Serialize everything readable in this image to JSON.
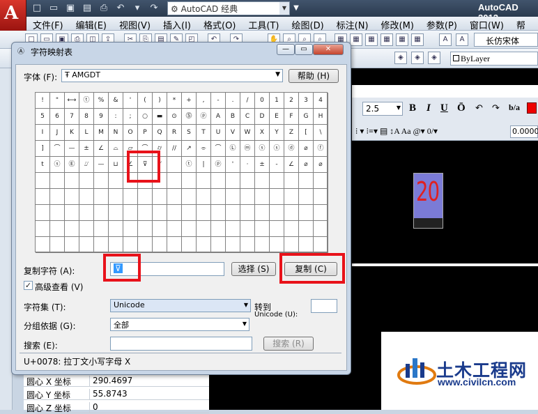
{
  "app": {
    "title": "AutoCAD 2012",
    "logo": "A",
    "workspace": "AutoCAD 经典"
  },
  "menus": [
    "文件(F)",
    "编辑(E)",
    "视图(V)",
    "插入(I)",
    "格式(O)",
    "工具(T)",
    "绘图(D)",
    "标注(N)",
    "修改(M)",
    "参数(P)",
    "窗口(W)",
    "帮"
  ],
  "toolbar": {
    "font_name": "长仿宋体",
    "layer_color": "ByLayer"
  },
  "text_editor": {
    "height": "2.5",
    "b": "B",
    "i": "I",
    "u": "U",
    "o": "Ō",
    "oblique": "0.0000",
    "color_accent": "#dd0000"
  },
  "drawing": {
    "mtext": "20"
  },
  "properties": [
    {
      "key": "圆心 X 坐标",
      "value": "290.4697"
    },
    {
      "key": "圆心 Y 坐标",
      "value": "55.8743"
    },
    {
      "key": "圆心 Z 坐标",
      "value": "0"
    }
  ],
  "watermark": {
    "name": "土木工程网",
    "url": "www.civilcn.com"
  },
  "dialog": {
    "title": "字符映射表",
    "font_label": "字体 (F):",
    "font_value": "AMGDT",
    "help_button": "帮助 (H)",
    "copy_label": "复制字符 (A):",
    "copy_value": "⊽",
    "select_button": "选择 (S)",
    "copy_button": "复制 (C)",
    "advanced_label": "高级查看 (V)",
    "advanced_checked": "✓",
    "charset_label": "字符集 (T):",
    "charset_value": "Unicode",
    "goto_label": "转到",
    "goto_label2": "Unicode (U):",
    "group_label": "分组依据 (G):",
    "group_value": "全部",
    "search_label": "搜索 (E):",
    "search_button": "搜索 (R)",
    "status": "U+0078: 拉丁文小写字母 X",
    "chars": [
      [
        "!",
        "\"",
        "⟷",
        "ⓣ",
        "%",
        "&",
        "'",
        "(",
        ")",
        "*",
        "+",
        ",",
        "-",
        ".",
        "/",
        "0",
        "1",
        "2",
        "3",
        "4"
      ],
      [
        "5",
        "6",
        "7",
        "8",
        "9",
        ":",
        ";",
        "○",
        "▬",
        "⊙",
        "⓹",
        "ⓟ",
        "A",
        "B",
        "C",
        "D",
        "E",
        "F",
        "G",
        "H"
      ],
      [
        "I",
        "J",
        "K",
        "L",
        "M",
        "N",
        "O",
        "P",
        "Q",
        "R",
        "S",
        "T",
        "U",
        "V",
        "W",
        "X",
        "Y",
        "Z",
        "[",
        "\\"
      ],
      [
        "]",
        "⌒",
        "—",
        "±",
        "∠",
        "⌓",
        "▱",
        "⌒",
        "⌭",
        "//",
        "↗",
        "⌯",
        "⌒",
        "Ⓛ",
        "ⓜ",
        "ⓢ",
        "ⓢ",
        "ⓓ",
        "⌀",
        "ⓕ"
      ],
      [
        "t",
        "ⓢ",
        "Ⓔ",
        "⌰",
        "—",
        "⊔",
        "∠",
        "⊽",
        "⟋",
        "",
        "ⓣ",
        "|",
        "ⓟ",
        "'",
        "·",
        "±",
        "-",
        "∠",
        "⌀",
        "⌀"
      ]
    ]
  }
}
